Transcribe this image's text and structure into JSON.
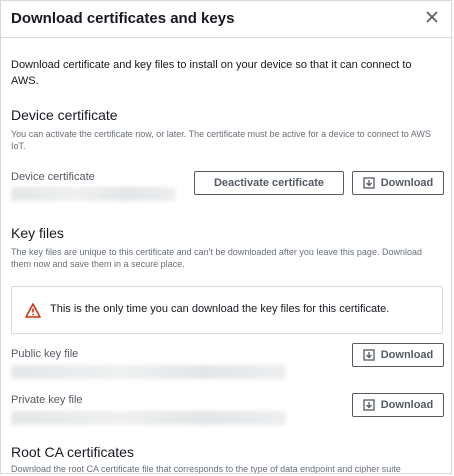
{
  "modal": {
    "title": "Download certificates and keys",
    "close_icon": "close-icon",
    "intro": "Download certificate and key files to install on your device so that it can connect to AWS."
  },
  "device_certificate": {
    "heading": "Device certificate",
    "description": "You can activate the certificate now, or later. The certificate must be active for a device to connect to AWS IoT.",
    "field_label": "Device certificate",
    "deactivate_label": "Deactivate certificate",
    "download_label": "Download"
  },
  "key_files": {
    "heading": "Key files",
    "description": "The key files are unique to this certificate and can't be downloaded after you leave this page. Download them now and save them in a secure place.",
    "alert_text": "This is the only time you can download the key files for this certificate.",
    "alert_icon": "warning-icon",
    "public_label": "Public key file",
    "public_download_label": "Download",
    "private_label": "Private key file",
    "private_download_label": "Download"
  },
  "root_ca": {
    "heading": "Root CA certificates",
    "description": "Download the root CA certificate file that corresponds to the type of data endpoint and cipher suite"
  },
  "colors": {
    "warning": "#d13212",
    "border": "#d5dbdb",
    "text": "#16191f",
    "muted": "#687078"
  }
}
